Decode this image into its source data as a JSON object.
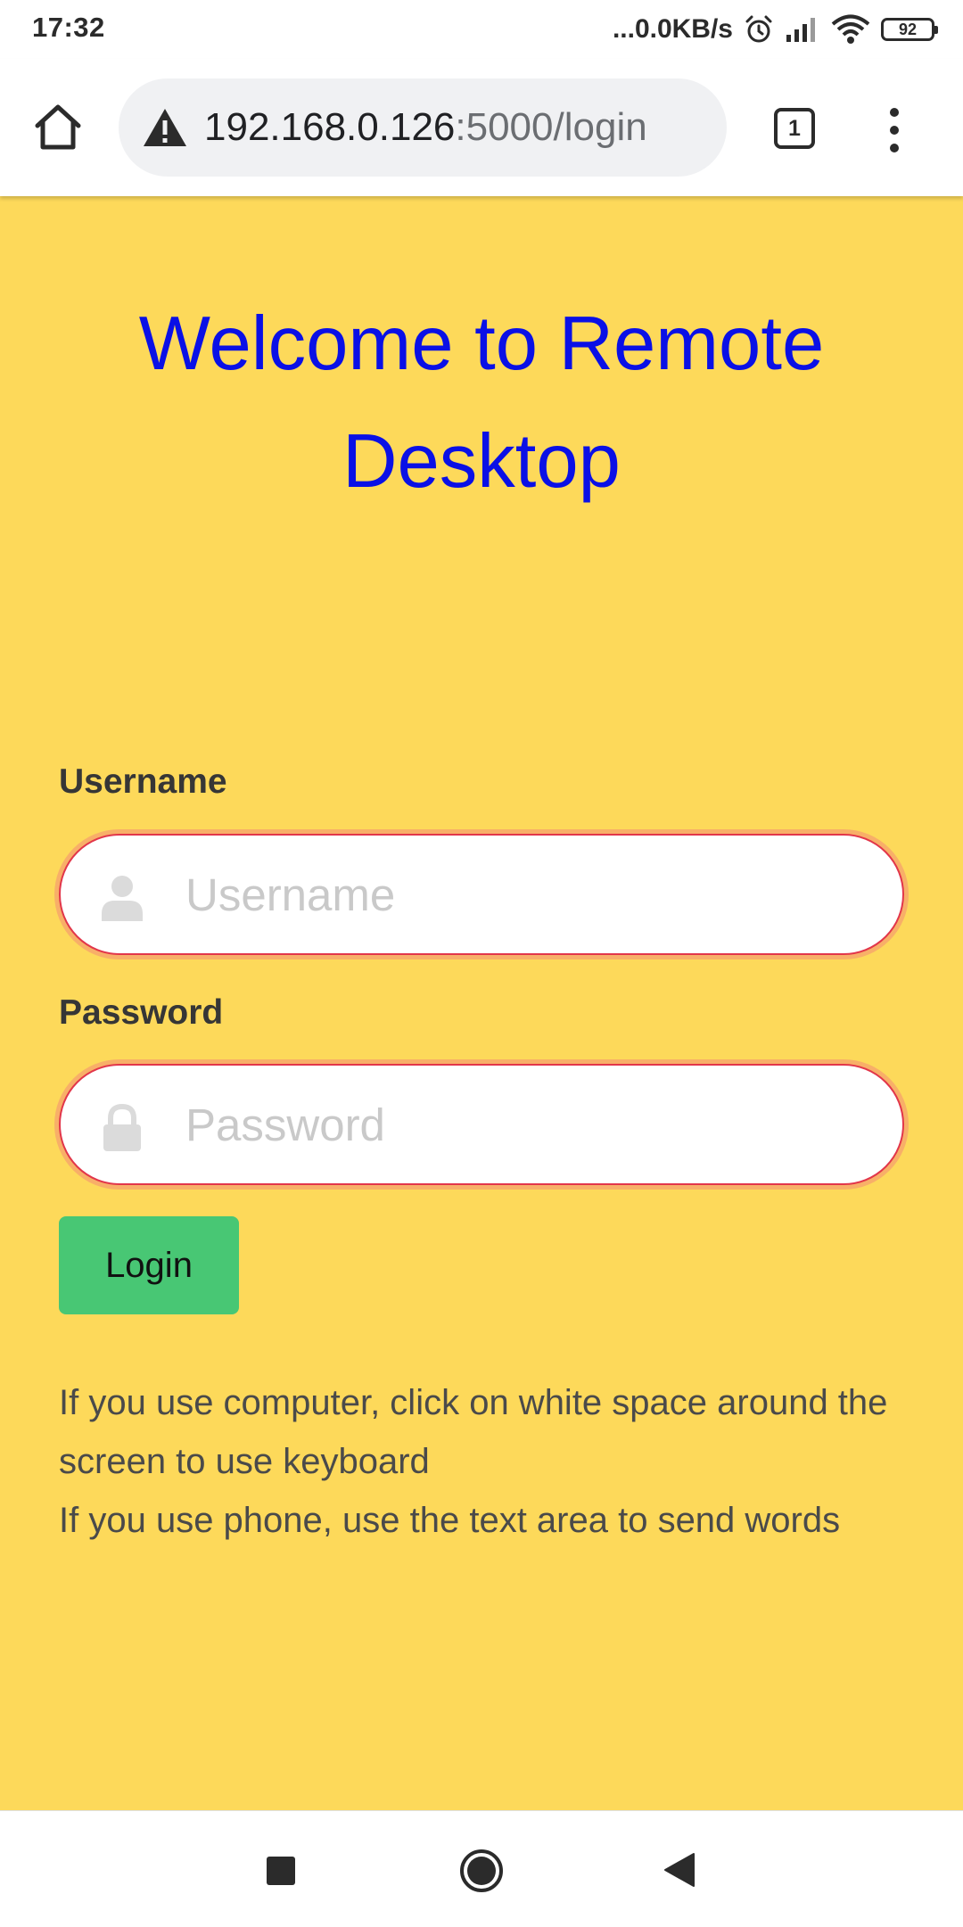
{
  "status_bar": {
    "time": "17:32",
    "network_speed": "...0.0KB/s",
    "battery": "92",
    "icons": [
      "alarm-icon",
      "signal-icon",
      "wifi-icon",
      "battery-icon"
    ]
  },
  "browser": {
    "url_host": "192.168.0.126",
    "url_path": ":5000/login",
    "tab_count": "1",
    "icons": [
      "home-icon",
      "warning-icon",
      "tabs-icon",
      "more-menu-icon"
    ]
  },
  "page": {
    "title": "Welcome to Remote Desktop",
    "username_label": "Username",
    "username_placeholder": "Username",
    "username_value": "",
    "password_label": "Password",
    "password_placeholder": "Password",
    "password_value": "",
    "login_button": "Login",
    "help_line_1": "If you use computer, click on white space around the screen to use keyboard",
    "help_line_2": "If you use phone, use the text area to send words"
  },
  "nav_bar": {
    "icons": [
      "recents-icon",
      "home-circle-icon",
      "back-icon"
    ]
  },
  "colors": {
    "page_background": "#fdd95a",
    "title": "#0a10e6",
    "login_button": "#48c774",
    "input_border": "#e2364a",
    "placeholder": "#c9c9c9"
  }
}
